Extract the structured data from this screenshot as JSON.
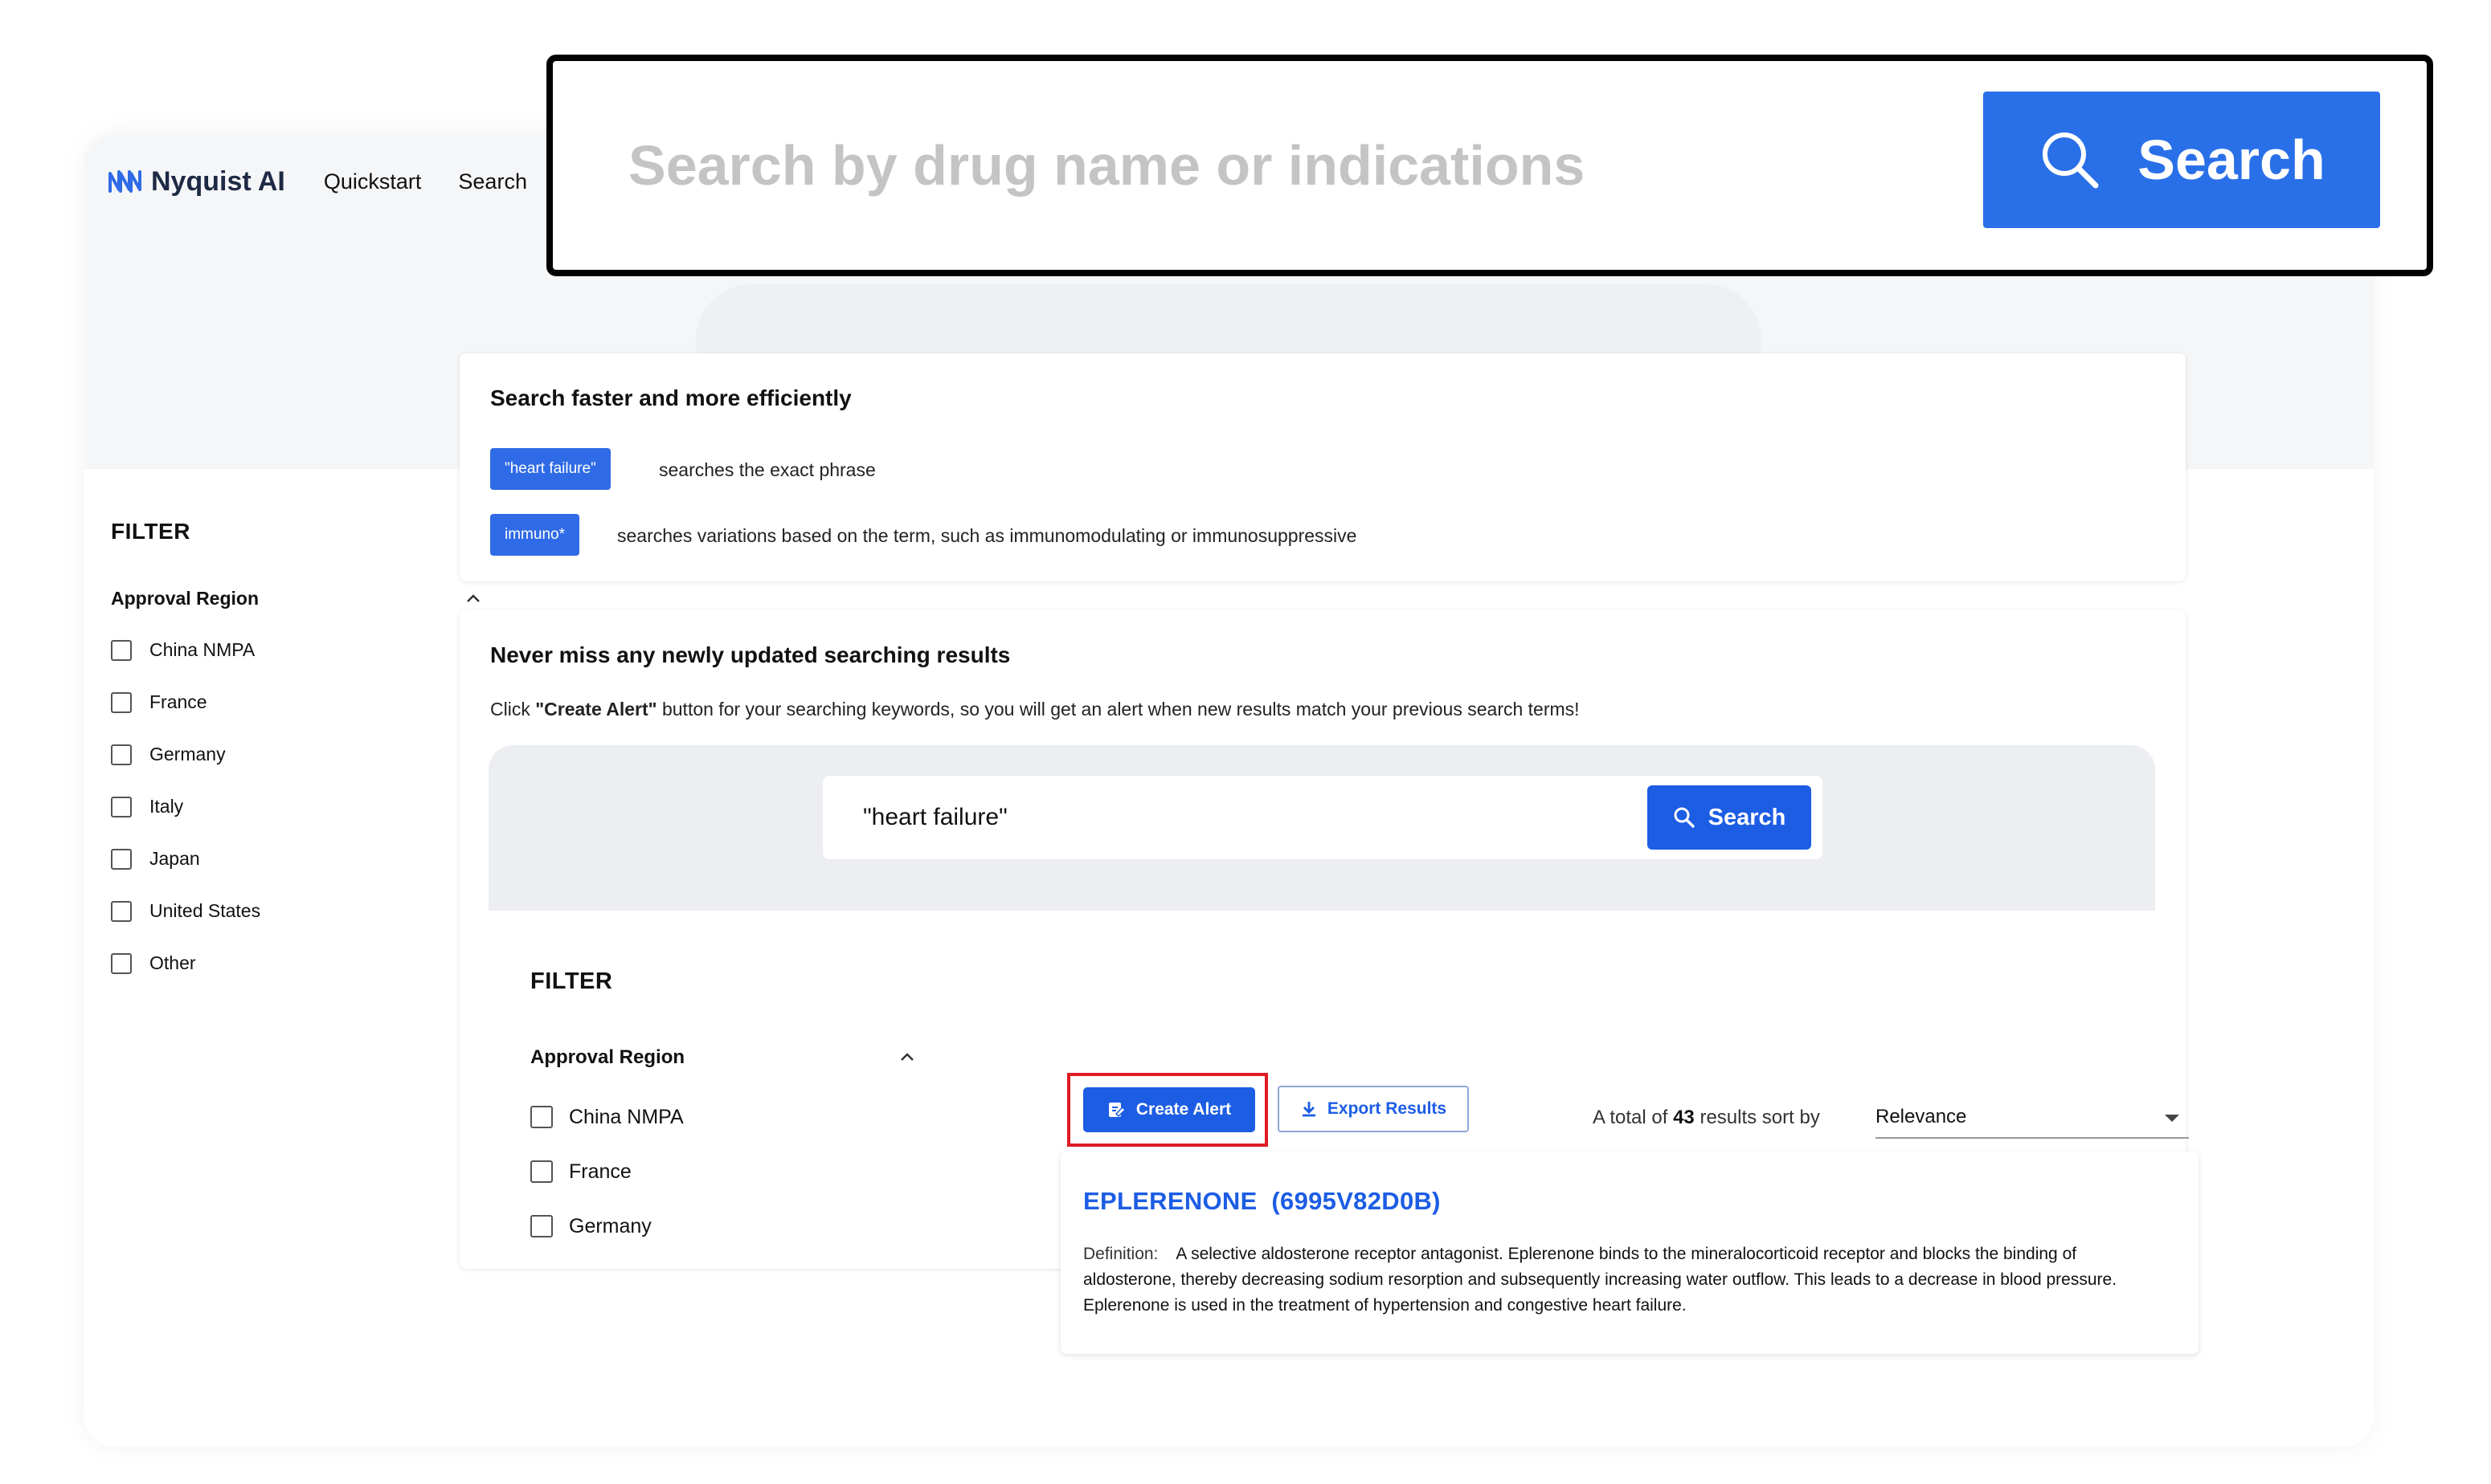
{
  "nav": {
    "logo_text": "Nyquist AI",
    "links": [
      "Quickstart",
      "Search"
    ]
  },
  "overlay": {
    "placeholder": "Search by drug name or indications",
    "button_label": "Search"
  },
  "sidebar_filter": {
    "title": "FILTER",
    "region_title": "Approval Region",
    "options": [
      "China NMPA",
      "France",
      "Germany",
      "Italy",
      "Japan",
      "United States",
      "Other"
    ]
  },
  "tips": {
    "title": "Search faster and more efficiently",
    "items": [
      {
        "tag": "\"heart failure\"",
        "desc": "searches the exact phrase"
      },
      {
        "tag": "immuno*",
        "desc": "searches variations based on the term, such as immunomodulating or immunosuppressive"
      }
    ]
  },
  "alert_card": {
    "title": "Never miss any newly updated searching results",
    "desc_prefix": "Click ",
    "desc_bold": "\"Create Alert\"",
    "desc_suffix": " button for your searching keywords, so you will get an alert when new results match your previous search terms!",
    "search_value": "\"heart failure\"",
    "search_button": "Search",
    "filter_title": "FILTER",
    "region_title": "Approval Region",
    "filter_options": [
      "China NMPA",
      "France",
      "Germany"
    ],
    "create_alert": "Create Alert",
    "export_results": "Export Results",
    "total_prefix": "A total of ",
    "total_count": "43",
    "total_suffix": " results sort by",
    "sort_value": "Relevance",
    "result": {
      "title": "EPLERENONE  (6995V82D0B)",
      "def_label": "Definition:",
      "def_text": "A selective aldosterone receptor antagonist. Eplerenone binds to the mineralocorticoid receptor and blocks the binding of aldosterone, thereby decreasing sodium resorption and subsequently increasing water outflow. This leads to a decrease in blood pressure. Eplerenone is used in the treatment of hypertension and congestive heart failure."
    }
  },
  "colors": {
    "primary": "#1c5de4",
    "highlight": "#e01b24"
  }
}
